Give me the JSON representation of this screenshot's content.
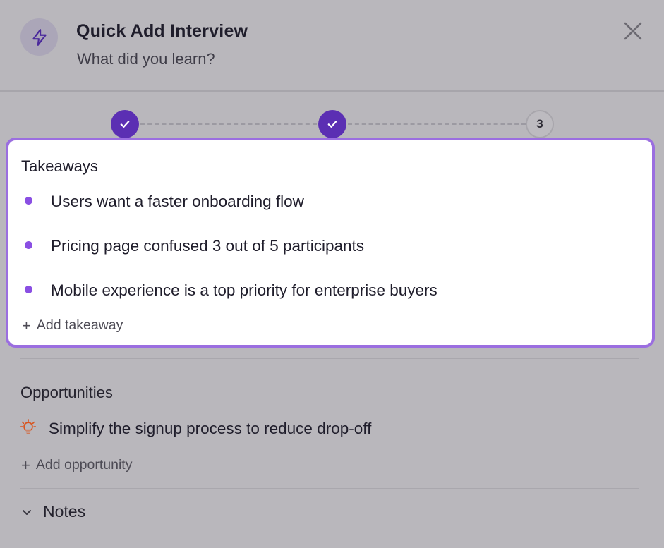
{
  "header": {
    "title": "Quick Add Interview",
    "subtitle": "What did you learn?",
    "icon": "lightning-icon",
    "close_icon": "close-icon"
  },
  "stepper": {
    "steps": [
      {
        "state": "complete",
        "label": ""
      },
      {
        "state": "complete",
        "label": ""
      },
      {
        "state": "current",
        "label": "3"
      }
    ]
  },
  "takeaways": {
    "title": "Takeaways",
    "items": [
      "Users want a faster onboarding flow",
      "Pricing page confused 3 out of 5 participants",
      "Mobile experience is a top priority for enterprise buyers"
    ],
    "add_label": "Add takeaway"
  },
  "opportunities": {
    "title": "Opportunities",
    "items": [
      "Simplify the signup process to reduce drop-off"
    ],
    "add_label": "Add opportunity"
  },
  "notes": {
    "label": "Notes"
  },
  "colors": {
    "accent": "#5b2fb3",
    "bullet": "#8a4fe3",
    "card_border": "#9b6ee0",
    "opportunity_icon": "#d9541e",
    "overlay": "#b9b7bc"
  }
}
